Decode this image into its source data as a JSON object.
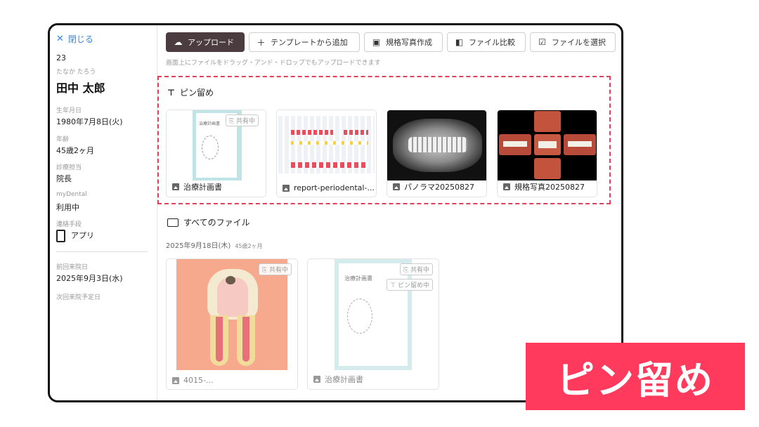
{
  "sidebar": {
    "close_label": "閉じる",
    "patient_id": "23",
    "kana": "たなか たろう",
    "name": "田中 太郎",
    "birth_label": "生年月日",
    "birth_value": "1980年7月8日(火)",
    "age_label": "年齢",
    "age_value": "45歳2ヶ月",
    "doctor_label": "診療担当",
    "doctor_value": "院長",
    "mydental_label": "myDental",
    "mydental_value": "利用中",
    "contact_label": "連絡手段",
    "contact_value": "アプリ",
    "last_visit_label": "前回来院日",
    "last_visit_value": "2025年9月3日(水)",
    "next_visit_label": "次回来院予定日"
  },
  "toolbar": {
    "upload": "アップロード",
    "template": "テンプレートから追加",
    "photo": "規格写真作成",
    "compare": "ファイル比較",
    "select": "ファイルを選択"
  },
  "hint": "画面上にファイルをドラッグ・アンド・ドロップでもアップロードできます",
  "pinned": {
    "title": "ピン留め",
    "items": [
      {
        "name": "治療計画書",
        "badge": "共有中",
        "doc_title": "治療計画書"
      },
      {
        "name": "report-periodental-..."
      },
      {
        "name": "パノラマ20250827"
      },
      {
        "name": "規格写真20250827"
      }
    ]
  },
  "all_files": {
    "title": "すべてのファイル",
    "date": "2025年9月18日(木)",
    "age": "45歳2ヶ月",
    "items": [
      {
        "name": "4015-...",
        "badge": "共有中"
      },
      {
        "name": "治療計画書",
        "badge": "共有中",
        "badge2": "ピン留め中",
        "doc_title": "治療計画書"
      }
    ]
  },
  "overlay_label": "ピン留め"
}
